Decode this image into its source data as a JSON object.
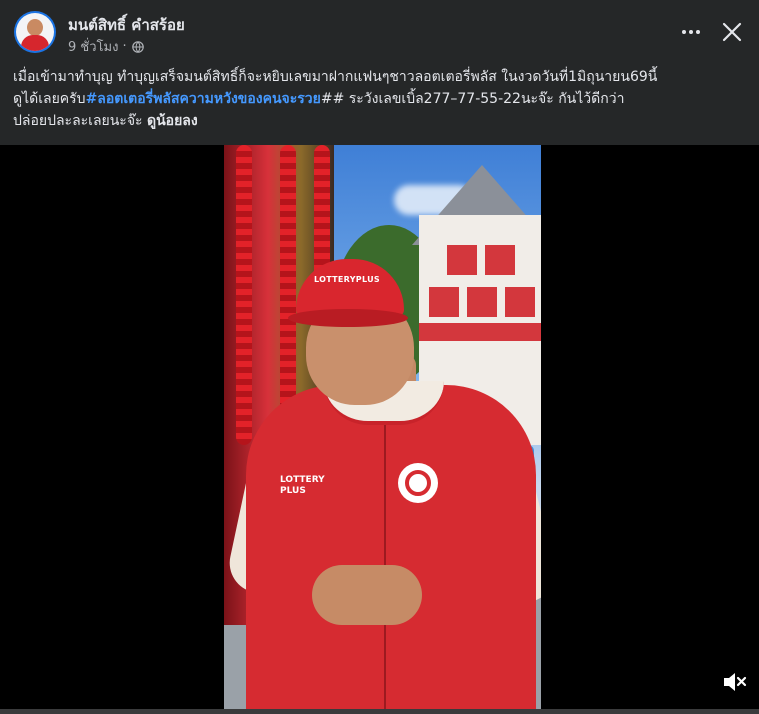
{
  "post": {
    "author": "มนต์สิทธิ์ คำสร้อย",
    "time": "9 ชั่วโมง",
    "separator": "·",
    "privacy_icon": "globe-icon",
    "more_icon": "more-icon",
    "close_icon": "close-icon"
  },
  "caption": {
    "line1": "เมื่อเข้ามาทำบุญ  ทำบุญเสร็จมนต์สิทธิ์ก็จะหยิบเลขมาฝากแฟนๆชาวลอตเตอรี่พลัส ในงวดวันที่1มิถุนายน69นี้",
    "line2_prefix": "ดูได้เลยครับ",
    "hashtag": "#ลอตเตอรี่พลัสความหวังของคนจะรวย",
    "line2_suffix": "## ระวังเลขเบิ้ล277–77-55-22นะจ๊ะ กันไว้ดีกว่า",
    "line3_prefix": "ปล่อยปละละเลยนะจ๊ะ",
    "line3_bold": "ดูน้อยลง"
  },
  "video": {
    "cap_logo": "LOTTERYPLUS",
    "chest_text_1": "LOTTERY",
    "chest_text_2": "PLUS",
    "progress": 0.0,
    "mute_icon": "speaker-muted-icon"
  },
  "colors": {
    "background": "#252728",
    "hashtag": "#4599ff",
    "jacket": "#d62b31"
  }
}
